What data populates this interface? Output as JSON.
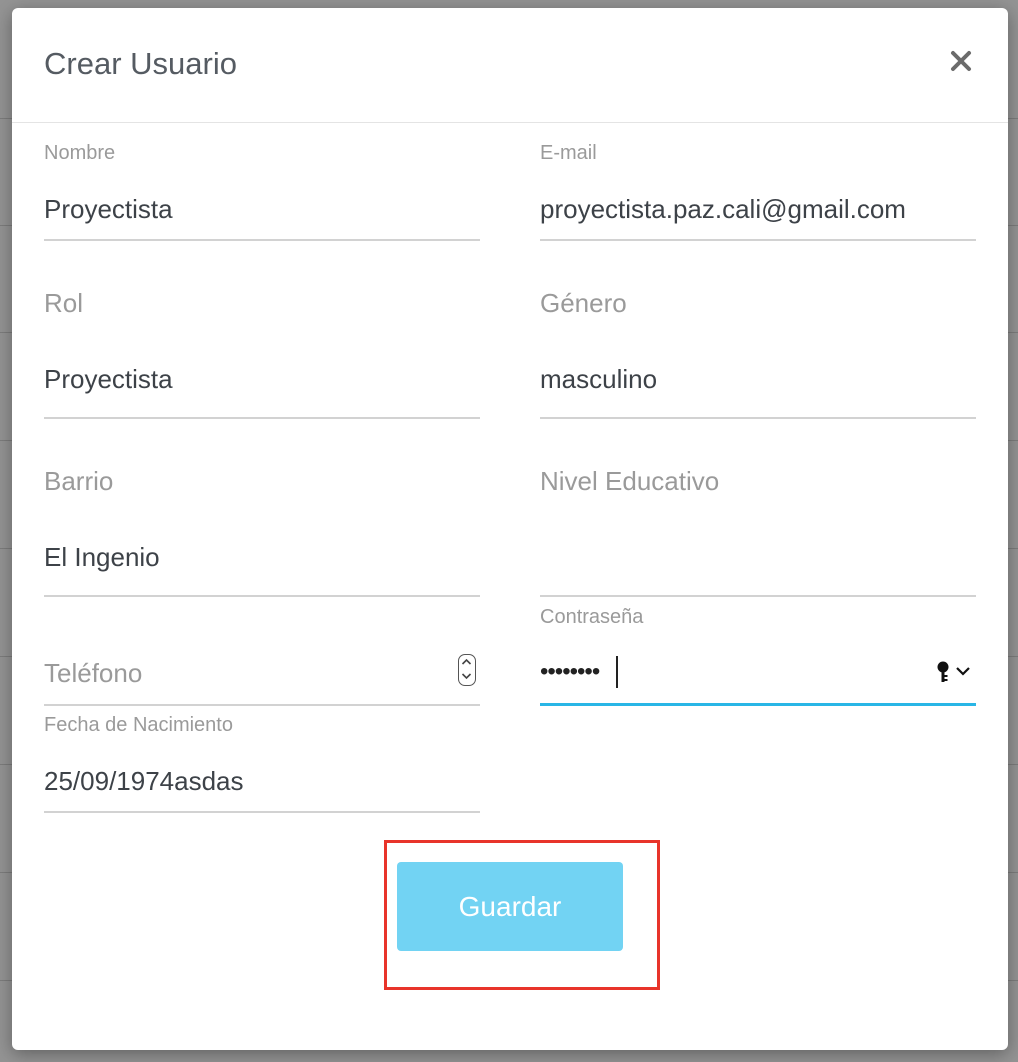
{
  "modal": {
    "title": "Crear Usuario",
    "close_icon": "close-icon"
  },
  "form": {
    "nombre": {
      "label": "Nombre",
      "value": "Proyectista"
    },
    "email": {
      "label": "E-mail",
      "value": "proyectista.paz.cali@gmail.com"
    },
    "rol": {
      "label": "Rol",
      "value": "Proyectista"
    },
    "genero": {
      "label": "Género",
      "value": "masculino"
    },
    "barrio": {
      "label": "Barrio",
      "value": "El Ingenio"
    },
    "nivel_educativo": {
      "label": "Nivel Educativo",
      "value": ""
    },
    "telefono": {
      "placeholder": "Teléfono",
      "value": ""
    },
    "contrasena": {
      "label": "Contraseña",
      "masked_value": "••••••••"
    },
    "fecha_nacimiento": {
      "label": "Fecha de Nacimiento",
      "value": "25/09/1974asdas"
    }
  },
  "actions": {
    "save_label": "Guardar"
  },
  "colors": {
    "accent": "#29b6e6",
    "button": "#72d3f3",
    "highlight": "#e8342a"
  }
}
